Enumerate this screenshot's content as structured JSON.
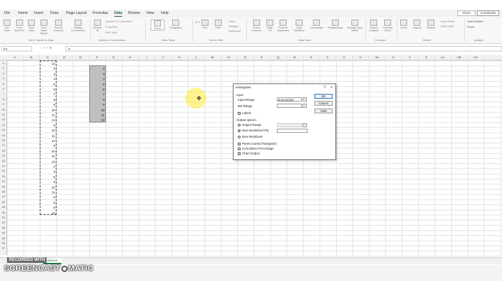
{
  "menu": {
    "tabs": [
      "File",
      "Home",
      "Insert",
      "Draw",
      "Page Layout",
      "Formulas",
      "Data",
      "Review",
      "View",
      "Help"
    ],
    "active_tab": "Data",
    "share": "Share",
    "comments": "Comments"
  },
  "ribbon": {
    "groups": [
      "Get & Transform Data",
      "Queries & Connections",
      "Data Types",
      "Sort & Filter",
      "Data Tools",
      "Forecast",
      "Outline",
      "Analyze"
    ],
    "buttons": {
      "get_data": "Get Data",
      "from_text": "From Text/CSV",
      "from_web": "From Web",
      "from_table": "From Table/ Range",
      "recent": "Recent Sources",
      "existing": "Existing Connections",
      "refresh": "Refresh All",
      "queries": "Queries & Connections",
      "properties": "Properties",
      "edit_links": "Edit Links",
      "stocks": "Stocks",
      "geography": "Geography",
      "sort_az": "A↓Z",
      "sort": "Sort",
      "filter": "Filter",
      "clear": "Clear",
      "reapply": "Reapply",
      "advanced": "Advanced",
      "text_to_columns": "Text to Columns",
      "flash_fill": "Flash Fill",
      "remove_dup": "Remove Duplicates",
      "data_validation": "Data Validation",
      "consolidate": "Consolidate",
      "relationships": "Relationships",
      "manage_model": "Manage Data Model",
      "what_if": "What-If Analysis",
      "forecast_sheet": "Forecast Sheet",
      "group": "Group",
      "ungroup": "Ungroup",
      "subtotal": "Subtotal",
      "show_detail": "Show Detail",
      "hide_detail": "Hide Detail",
      "data_analysis": "Data Analysis",
      "solver": "Solver"
    }
  },
  "formula_bar": {
    "name_box": "C1",
    "formula": "2"
  },
  "grid": {
    "columns": [
      "A",
      "B",
      "C",
      "D",
      "E",
      "F",
      "G",
      "H",
      "I",
      "J",
      "K",
      "L",
      "M",
      "N",
      "O",
      "P",
      "Q",
      "R",
      "S",
      "T",
      "U",
      "V",
      "W",
      "X",
      "Y",
      "Z",
      "AA",
      "AB",
      "AC"
    ],
    "rows": [
      "1",
      "2",
      "3",
      "4",
      "5",
      "6",
      "7",
      "8",
      "9",
      "10",
      "11",
      "12",
      "13",
      "14",
      "15",
      "16",
      "17",
      "18",
      "19",
      "20",
      "21",
      "22",
      "23",
      "24",
      "25",
      "26",
      "27",
      "28",
      "29",
      "30",
      "31",
      "32",
      "33",
      "34",
      "35",
      "36",
      "37"
    ],
    "col_c": [
      "12",
      "2",
      "3",
      "4",
      "5",
      "6",
      "7",
      "8",
      "9",
      "10",
      "11",
      "12",
      "9",
      "10",
      "11",
      "13",
      "9",
      "10",
      "11",
      "12",
      "2",
      "4",
      "6",
      "9",
      "10",
      "11",
      "5",
      "6",
      "8",
      "10"
    ],
    "col_f": [
      "2",
      "3",
      "4",
      "5",
      "6",
      "7",
      "8",
      "9",
      "10",
      "11",
      "12"
    ]
  },
  "dialog": {
    "title": "Histogram",
    "help": "?",
    "close": "×",
    "input_section": "Input",
    "input_range_label": "Input Range:",
    "input_range_value": "$C$1:$C$30",
    "bin_range_label": "Bin Range:",
    "bin_range_value": "",
    "labels": "Labels",
    "output_section": "Output options",
    "output_range": "Output Range:",
    "new_worksheet": "New Worksheet Ply:",
    "new_workbook": "New Workbook",
    "pareto": "Pareto (sorted histogram)",
    "cumulative": "Cumulative Percentage",
    "chart_output": "Chart Output",
    "ok": "OK",
    "cancel": "Cancel",
    "help_btn": "Help"
  },
  "sheets": [
    "Sheet2"
  ],
  "watermark": {
    "line1": "RECORDED WITH",
    "line2a": "SCREENCAST",
    "line2b": "MATIC"
  }
}
